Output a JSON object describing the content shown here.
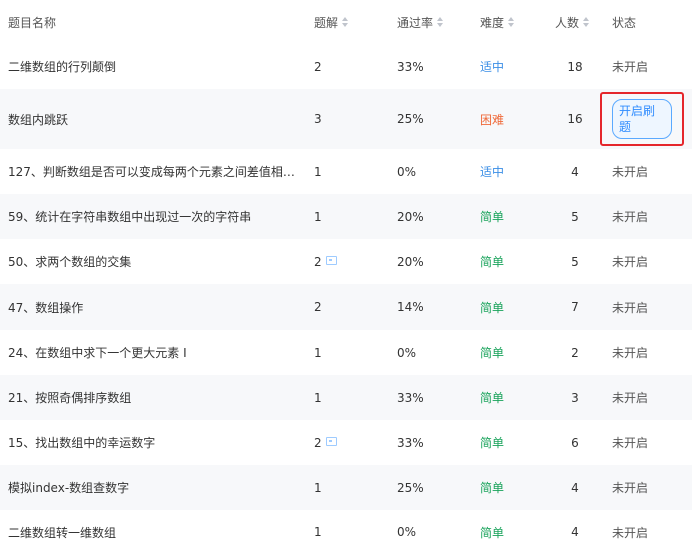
{
  "colors": {
    "moderate": "#3a8ee6",
    "hard": "#ef6a3a",
    "easy": "#19a35b",
    "highlight": "#e5262b",
    "row_alt": "#f7f8fa"
  },
  "table": {
    "headers": {
      "name": "题目名称",
      "solutions": "题解",
      "pass_rate": "通过率",
      "difficulty": "难度",
      "count": "人数",
      "status": "状态"
    },
    "rows": [
      {
        "name": "二维数组的行列颠倒",
        "solutions": "2",
        "pass_rate": "33%",
        "difficulty": "适中",
        "count": "18",
        "status": "未开启"
      },
      {
        "name": "数组内跳跃",
        "solutions": "3",
        "pass_rate": "25%",
        "difficulty": "困难",
        "count": "16",
        "status": "开启刷题"
      },
      {
        "name": "127、判断数组是否可以变成每两个元素之间差值相等...",
        "solutions": "1",
        "pass_rate": "0%",
        "difficulty": "适中",
        "count": "4",
        "status": "未开启"
      },
      {
        "name": "59、统计在字符串数组中出现过一次的字符串",
        "solutions": "1",
        "pass_rate": "20%",
        "difficulty": "简单",
        "count": "5",
        "status": "未开启"
      },
      {
        "name": "50、求两个数组的交集",
        "solutions": "2",
        "pass_rate": "20%",
        "difficulty": "简单",
        "count": "5",
        "status": "未开启"
      },
      {
        "name": "47、数组操作",
        "solutions": "2",
        "pass_rate": "14%",
        "difficulty": "简单",
        "count": "7",
        "status": "未开启"
      },
      {
        "name": "24、在数组中求下一个更大元素 I",
        "solutions": "1",
        "pass_rate": "0%",
        "difficulty": "简单",
        "count": "2",
        "status": "未开启"
      },
      {
        "name": "21、按照奇偶排序数组",
        "solutions": "1",
        "pass_rate": "33%",
        "difficulty": "简单",
        "count": "3",
        "status": "未开启"
      },
      {
        "name": "15、找出数组中的幸运数字",
        "solutions": "2",
        "pass_rate": "33%",
        "difficulty": "简单",
        "count": "6",
        "status": "未开启"
      },
      {
        "name": "模拟index-数组查数字",
        "solutions": "1",
        "pass_rate": "25%",
        "difficulty": "简单",
        "count": "4",
        "status": "未开启"
      },
      {
        "name": "二维数组转一维数组",
        "solutions": "1",
        "pass_rate": "0%",
        "difficulty": "简单",
        "count": "4",
        "status": "未开启"
      }
    ]
  }
}
